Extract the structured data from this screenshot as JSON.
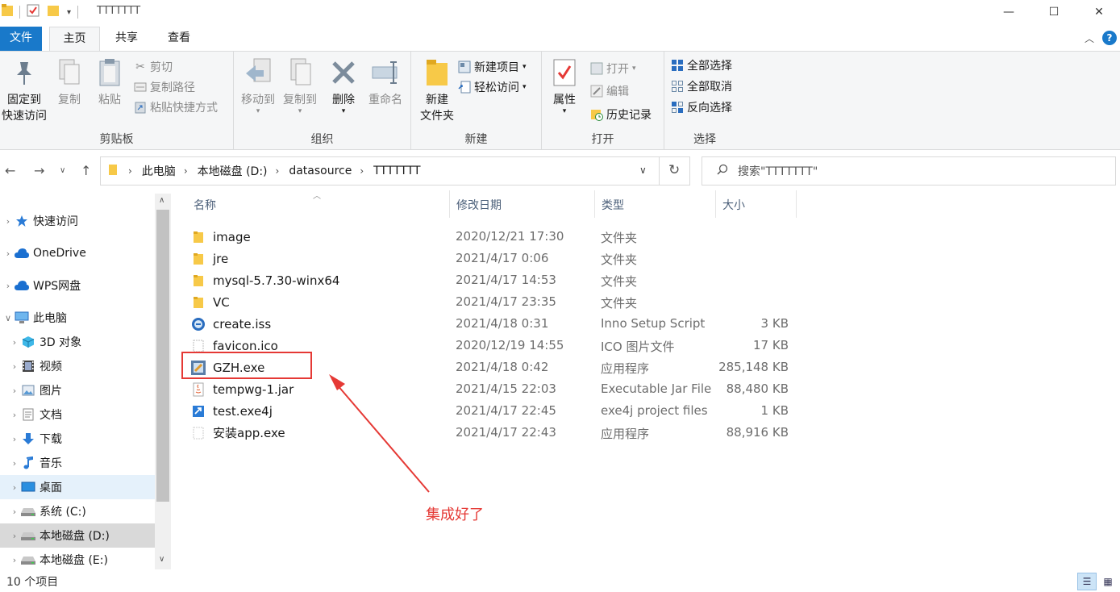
{
  "window": {
    "title": "TTTTTTT",
    "minimize": "—",
    "maximize": "☐",
    "close": "✕"
  },
  "ribbon_tabs": [
    "文件",
    "主页",
    "共享",
    "查看"
  ],
  "ribbon": {
    "clipboard": {
      "label": "剪贴板",
      "pin_line1": "固定到",
      "pin_line2": "快速访问",
      "copy": "复制",
      "paste": "粘贴",
      "cut": "剪切",
      "copy_path": "复制路径",
      "paste_shortcut": "粘贴快捷方式"
    },
    "organize": {
      "label": "组织",
      "move_to": "移动到",
      "copy_to": "复制到",
      "delete": "删除",
      "rename": "重命名"
    },
    "new": {
      "label": "新建",
      "new_folder_line1": "新建",
      "new_folder_line2": "文件夹",
      "new_item": "新建项目",
      "easy_access": "轻松访问"
    },
    "open": {
      "label": "打开",
      "properties": "属性",
      "open": "打开",
      "edit": "编辑",
      "history": "历史记录"
    },
    "select": {
      "label": "选择",
      "select_all": "全部选择",
      "select_none": "全部取消",
      "invert": "反向选择"
    }
  },
  "address": {
    "crumbs": [
      "此电脑",
      "本地磁盘 (D:)",
      "datasource",
      "TTTTTTT"
    ],
    "search_placeholder": "搜索\"TTTTTTT\""
  },
  "nav_pane": [
    {
      "label": "快速访问",
      "icon": "star-icon",
      "level": 0
    },
    {
      "label": "OneDrive",
      "icon": "cloud-icon",
      "level": 0
    },
    {
      "label": "WPS网盘",
      "icon": "cloud-icon",
      "level": 0
    },
    {
      "label": "此电脑",
      "icon": "computer-icon",
      "level": 0,
      "expanded": true
    },
    {
      "label": "3D 对象",
      "icon": "cube-icon",
      "level": 1
    },
    {
      "label": "视频",
      "icon": "video-icon",
      "level": 1
    },
    {
      "label": "图片",
      "icon": "picture-icon",
      "level": 1
    },
    {
      "label": "文档",
      "icon": "document-icon",
      "level": 1
    },
    {
      "label": "下载",
      "icon": "download-icon",
      "level": 1
    },
    {
      "label": "音乐",
      "icon": "music-icon",
      "level": 1
    },
    {
      "label": "桌面",
      "icon": "desktop-icon",
      "level": 1,
      "selected": true
    },
    {
      "label": "系统 (C:)",
      "icon": "drive-icon",
      "level": 1
    },
    {
      "label": "本地磁盘 (D:)",
      "icon": "drive-icon",
      "level": 1,
      "hover": true
    },
    {
      "label": "本地磁盘 (E:)",
      "icon": "drive-icon",
      "level": 1
    }
  ],
  "columns": {
    "name": "名称",
    "modified": "修改日期",
    "type": "类型",
    "size": "大小"
  },
  "files": [
    {
      "name": "image",
      "modified": "2020/12/21 17:30",
      "type": "文件夹",
      "size": "",
      "icon": "folder-icon"
    },
    {
      "name": "jre",
      "modified": "2021/4/17 0:06",
      "type": "文件夹",
      "size": "",
      "icon": "folder-icon"
    },
    {
      "name": "mysql-5.7.30-winx64",
      "modified": "2021/4/17 14:53",
      "type": "文件夹",
      "size": "",
      "icon": "folder-icon"
    },
    {
      "name": "VC",
      "modified": "2021/4/17 23:35",
      "type": "文件夹",
      "size": "",
      "icon": "folder-icon"
    },
    {
      "name": "create.iss",
      "modified": "2021/4/18 0:31",
      "type": "Inno Setup Script",
      "size": "3 KB",
      "icon": "script-icon"
    },
    {
      "name": "favicon.ico",
      "modified": "2020/12/19 14:55",
      "type": "ICO 图片文件",
      "size": "17 KB",
      "icon": "image-file-icon"
    },
    {
      "name": "GZH.exe",
      "modified": "2021/4/18 0:42",
      "type": "应用程序",
      "size": "285,148 KB",
      "icon": "app-icon"
    },
    {
      "name": "tempwg-1.jar",
      "modified": "2021/4/15 22:03",
      "type": "Executable Jar File",
      "size": "88,480 KB",
      "icon": "java-icon"
    },
    {
      "name": "test.exe4j",
      "modified": "2021/4/17 22:45",
      "type": "exe4j project files",
      "size": "1 KB",
      "icon": "exe4j-icon"
    },
    {
      "name": "安装app.exe",
      "modified": "2021/4/17 22:43",
      "type": "应用程序",
      "size": "88,916 KB",
      "icon": "blank-file-icon"
    }
  ],
  "annotation": {
    "text": "集成好了",
    "color": "#e53935"
  },
  "status": {
    "count": "10 个项目"
  },
  "colors": {
    "accent": "#1979ca",
    "folder": "#f7c948",
    "selection": "#e5f1fb"
  }
}
